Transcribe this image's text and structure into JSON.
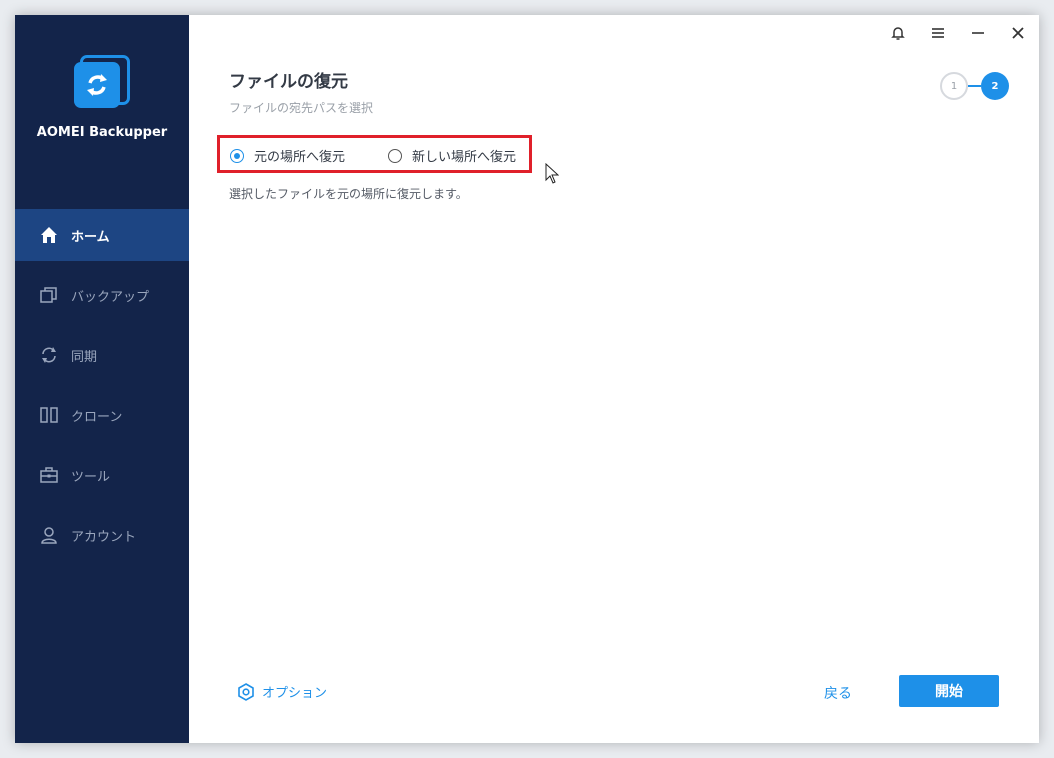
{
  "app": {
    "name": "AOMEI Backupper"
  },
  "sidebar": {
    "items": [
      {
        "label": "ホーム",
        "icon": "home-icon",
        "active": true
      },
      {
        "label": "バックアップ",
        "icon": "backup-icon",
        "active": false
      },
      {
        "label": "同期",
        "icon": "sync-icon",
        "active": false
      },
      {
        "label": "クローン",
        "icon": "clone-icon",
        "active": false
      },
      {
        "label": "ツール",
        "icon": "tools-icon",
        "active": false
      },
      {
        "label": "アカウント",
        "icon": "account-icon",
        "active": false
      }
    ]
  },
  "header": {
    "title": "ファイルの復元",
    "subtitle": "ファイルの宛先パスを選択"
  },
  "steps": {
    "step1": "1",
    "step2": "2"
  },
  "restore_options": {
    "original": "元の場所へ復元",
    "new": "新しい場所へ復元",
    "selected": "original"
  },
  "description": "選択したファイルを元の場所に復元します。",
  "footer": {
    "option_label": "オプション",
    "back_label": "戻る",
    "start_label": "開始"
  },
  "colors": {
    "accent": "#1e90e8",
    "sidebar_bg": "#13244a",
    "sidebar_active": "#1d4583",
    "highlight": "#e0202a"
  }
}
